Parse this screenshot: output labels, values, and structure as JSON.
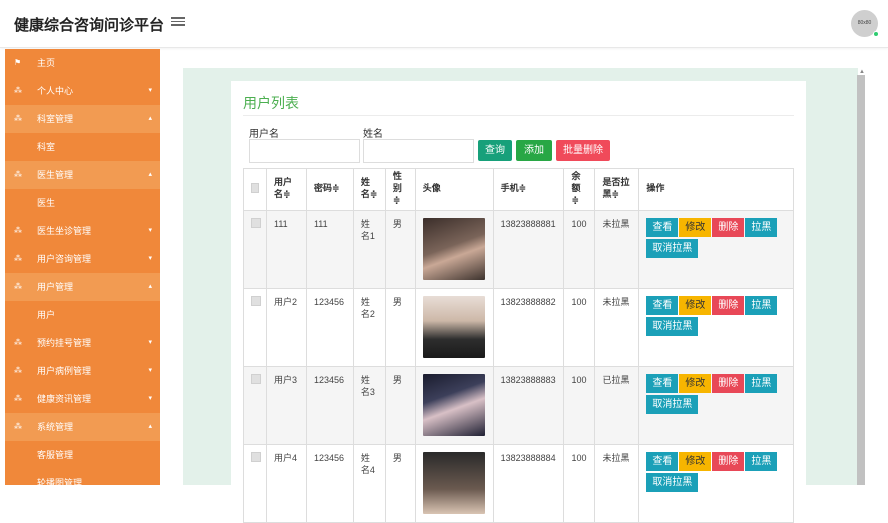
{
  "header": {
    "title": "健康综合咨询问诊平台",
    "avatar_text": "80x80"
  },
  "sidebar": {
    "items": [
      {
        "label": "主页",
        "icon": "flag-icon",
        "type": "top",
        "chevron": ""
      },
      {
        "label": "个人中心",
        "icon": "grid-icon",
        "type": "top",
        "chevron": "▾"
      },
      {
        "label": "科室管理",
        "icon": "grid-icon",
        "type": "open",
        "chevron": "▴"
      },
      {
        "label": "科室",
        "icon": "",
        "type": "sub",
        "chevron": ""
      },
      {
        "label": "医生管理",
        "icon": "grid-icon",
        "type": "open",
        "chevron": "▴"
      },
      {
        "label": "医生",
        "icon": "",
        "type": "sub",
        "chevron": ""
      },
      {
        "label": "医生坐诊管理",
        "icon": "grid-icon",
        "type": "top",
        "chevron": "▾"
      },
      {
        "label": "用户咨询管理",
        "icon": "grid-icon",
        "type": "top",
        "chevron": "▾"
      },
      {
        "label": "用户管理",
        "icon": "grid-icon",
        "type": "open",
        "chevron": "▴"
      },
      {
        "label": "用户",
        "icon": "",
        "type": "sub",
        "chevron": ""
      },
      {
        "label": "预约挂号管理",
        "icon": "grid-icon",
        "type": "top",
        "chevron": "▾"
      },
      {
        "label": "用户病例管理",
        "icon": "grid-icon",
        "type": "top",
        "chevron": "▾"
      },
      {
        "label": "健康资讯管理",
        "icon": "grid-icon",
        "type": "top",
        "chevron": "▾"
      },
      {
        "label": "系统管理",
        "icon": "grid-icon",
        "type": "open",
        "chevron": "▴"
      },
      {
        "label": "客服管理",
        "icon": "",
        "type": "sub",
        "chevron": ""
      },
      {
        "label": "轮播图管理",
        "icon": "",
        "type": "sub",
        "chevron": ""
      }
    ]
  },
  "main": {
    "title": "用户列表",
    "search": {
      "username_label": "用户名",
      "name_label": "姓名",
      "query_button": "查询",
      "add_button": "添加",
      "batch_delete_button": "批量删除"
    },
    "table": {
      "headers": [
        "",
        "用户名≑",
        "密码≑",
        "姓名≑",
        "性别≑",
        "头像",
        "手机≑",
        "余额≑",
        "是否拉黑≑",
        "操作"
      ],
      "rows": [
        {
          "username": "111",
          "password": "111",
          "name": "姓名1",
          "gender": "男",
          "photo": "ph1",
          "phone": "13823888881",
          "balance": "100",
          "blacklisted": "未拉黑"
        },
        {
          "username": "用户2",
          "password": "123456",
          "name": "姓名2",
          "gender": "男",
          "photo": "ph2",
          "phone": "13823888882",
          "balance": "100",
          "blacklisted": "未拉黑"
        },
        {
          "username": "用户3",
          "password": "123456",
          "name": "姓名3",
          "gender": "男",
          "photo": "ph3",
          "phone": "13823888883",
          "balance": "100",
          "blacklisted": "已拉黑"
        },
        {
          "username": "用户4",
          "password": "123456",
          "name": "姓名4",
          "gender": "男",
          "photo": "ph4",
          "phone": "13823888884",
          "balance": "100",
          "blacklisted": "未拉黑"
        }
      ],
      "actions": {
        "view": "查看",
        "edit": "修改",
        "delete": "删除",
        "blacklist": "拉黑",
        "unblacklist": "取消拉黑"
      }
    }
  },
  "colors": {
    "sidebar": "#f0883a",
    "title_green": "#4caf50",
    "query": "#17a07a",
    "add": "#28a745",
    "batch_delete": "#f04a5a"
  }
}
